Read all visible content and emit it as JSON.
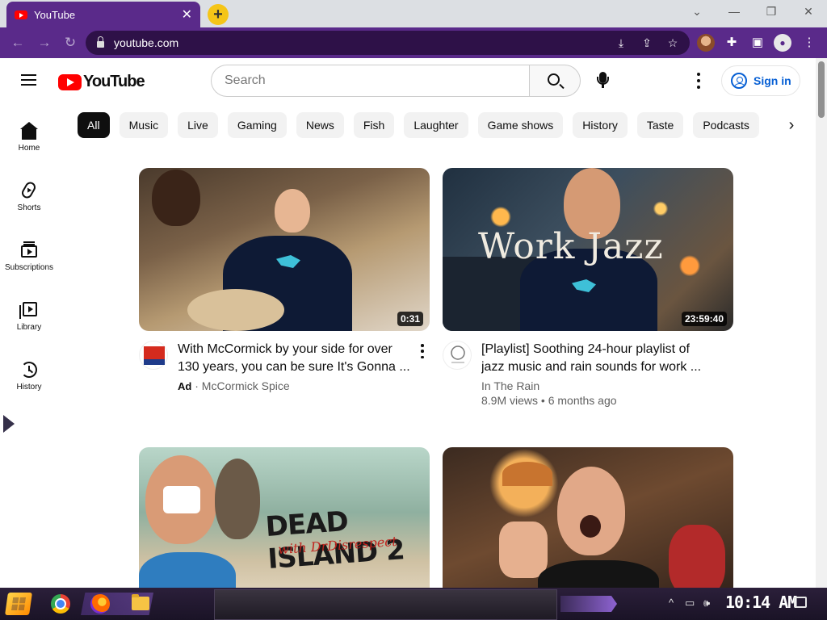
{
  "browser": {
    "tab_title": "YouTube",
    "tab_close": "✕",
    "new_tab": "+",
    "url": "youtube.com",
    "window_controls": {
      "chevron": "⌄",
      "minimize": "—",
      "restore": "❐",
      "close": "✕"
    },
    "toolbar_icons": [
      "install-icon",
      "share-icon",
      "star-icon",
      "profile-icon",
      "extensions-icon",
      "side-panel-icon",
      "account-icon",
      "menu-icon"
    ],
    "accent_color": "#5a2a8a"
  },
  "header": {
    "logo_text": "YouTube",
    "search_placeholder": "Search",
    "signin_label": "Sign in"
  },
  "guide": {
    "items": [
      {
        "label": "Home",
        "icon": "home-icon"
      },
      {
        "label": "Shorts",
        "icon": "shorts-icon"
      },
      {
        "label": "Subscriptions",
        "icon": "subscriptions-icon"
      },
      {
        "label": "Library",
        "icon": "library-icon"
      },
      {
        "label": "History",
        "icon": "history-icon"
      }
    ]
  },
  "chips": [
    "All",
    "Music",
    "Live",
    "Gaming",
    "News",
    "Fish",
    "Laughter",
    "Game shows",
    "History",
    "Taste",
    "Podcasts"
  ],
  "videos": [
    {
      "duration": "0:31",
      "title": "With McCormick by your side for over 130 years, you can be sure It's Gonna ...",
      "ad_label": "Ad",
      "separator": "·",
      "channel": "McCormick Spice",
      "avatar_text": "McCormick"
    },
    {
      "duration": "23:59:40",
      "title": "[Playlist] Soothing 24-hour playlist of jazz music and rain sounds for work ...",
      "channel": "In The Rain",
      "stats": "8.9M views • 6 months ago",
      "thumb_text": "Work    Jazz",
      "avatar_text": "IN THE RAIN"
    },
    {
      "thumb_text": "DEAD ISLAND 2",
      "thumb_sub": "with DrDisrespect"
    },
    {}
  ],
  "taskbar": {
    "clock": "10:14 AM",
    "tray_icons": [
      "chevron-up-icon",
      "network-icon",
      "volume-icon",
      "notification-icon"
    ]
  }
}
